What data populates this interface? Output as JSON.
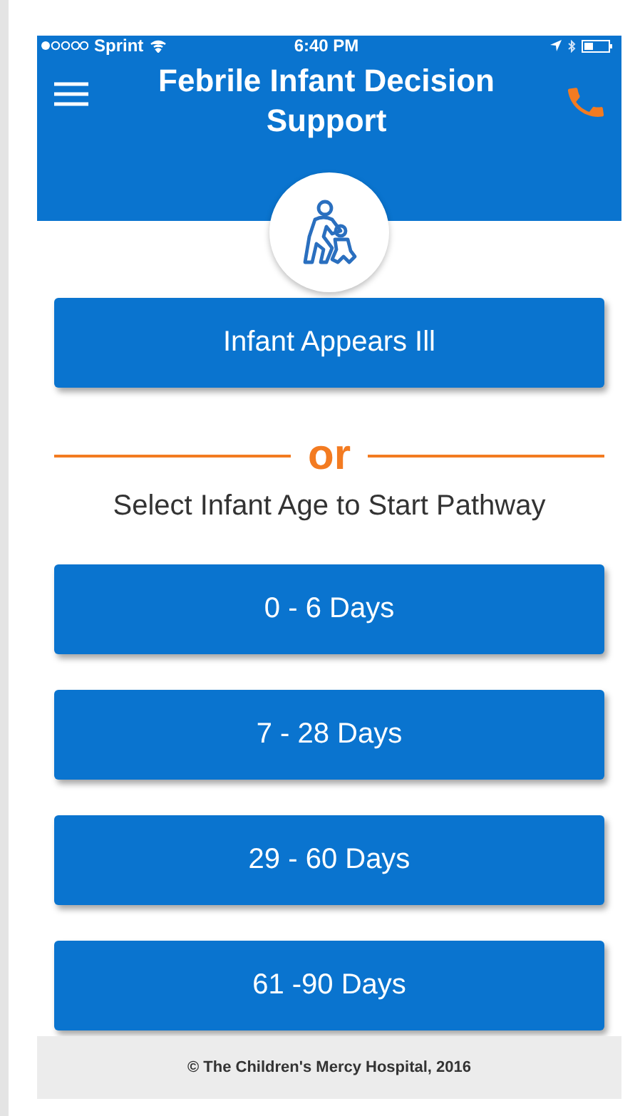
{
  "status_bar": {
    "carrier": "Sprint",
    "time": "6:40 PM"
  },
  "header": {
    "title": "Febrile Infant Decision Support"
  },
  "primary_button": "Infant Appears Ill",
  "divider_text": "or",
  "prompt": "Select Infant Age to Start Pathway",
  "age_buttons": [
    "0 - 6 Days",
    "7 - 28 Days",
    "29 - 60 Days",
    "61 -90 Days"
  ],
  "footer": "© The Children's Mercy Hospital, 2016"
}
